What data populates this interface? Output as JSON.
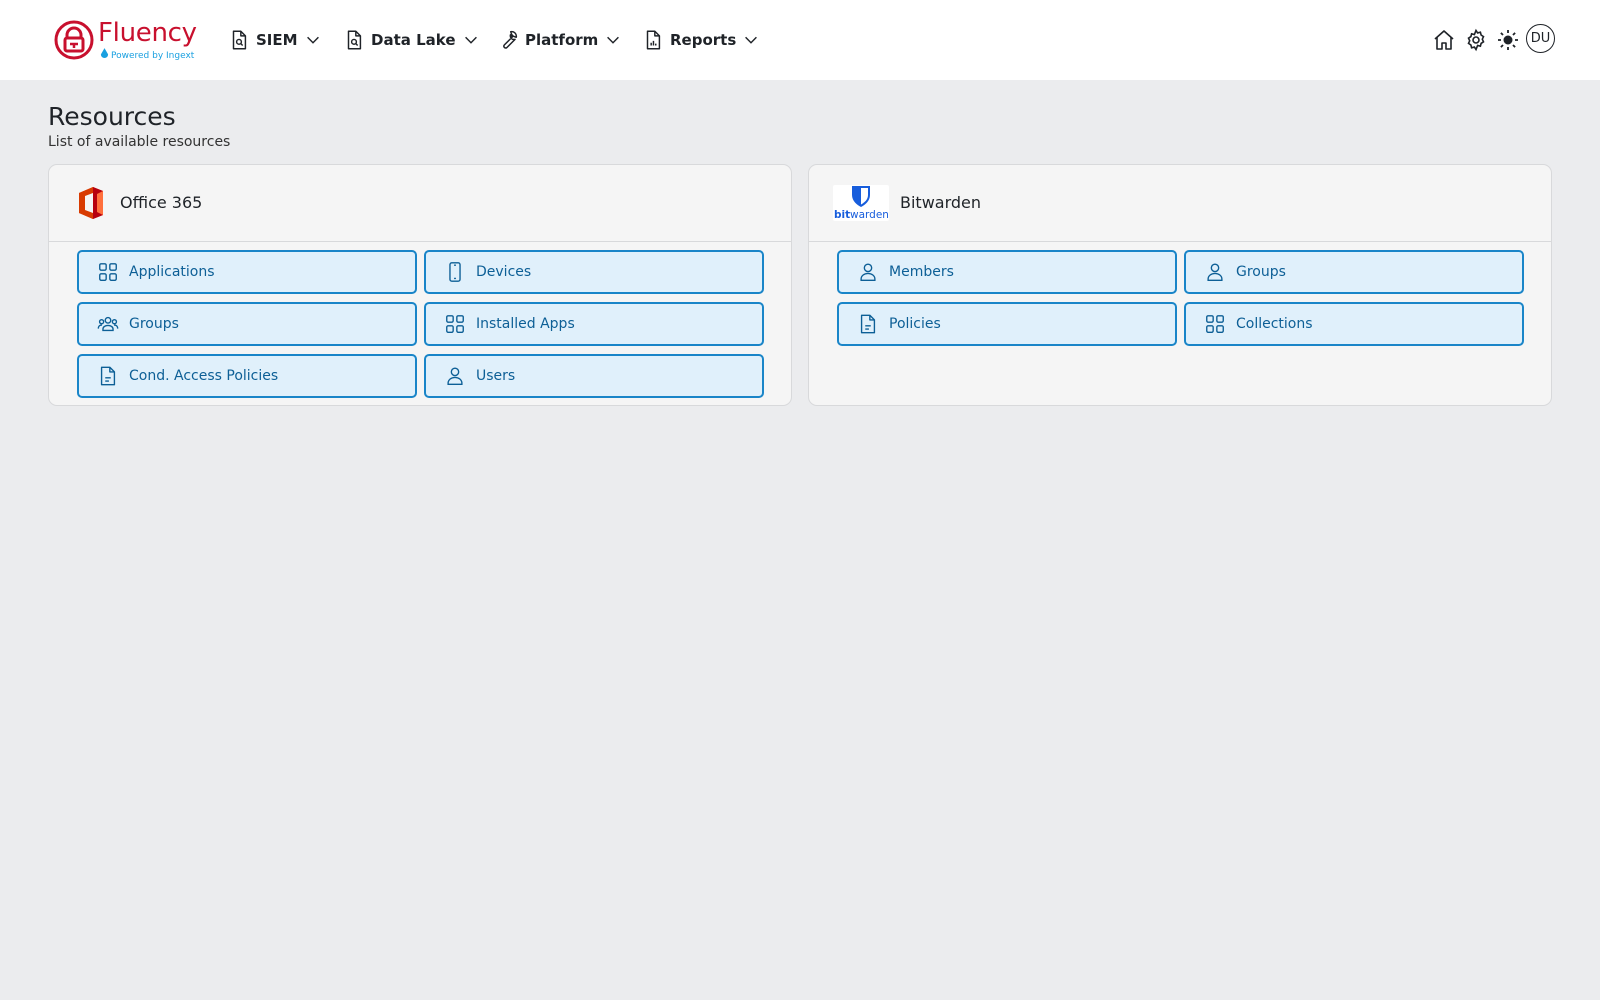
{
  "header": {
    "logo_name": "Fluency",
    "logo_subtitle": "Powered by Ingext",
    "nav": [
      {
        "label": "SIEM"
      },
      {
        "label": "Data Lake"
      },
      {
        "label": "Platform"
      },
      {
        "label": "Reports"
      }
    ],
    "avatar_initials": "DU",
    "icons": [
      "home-icon",
      "gear-icon",
      "sun-icon"
    ]
  },
  "page": {
    "title": "Resources",
    "subtitle": "List of available resources"
  },
  "resources": [
    {
      "name": "Office 365",
      "items": [
        {
          "label": "Applications",
          "icon": "grid-icon"
        },
        {
          "label": "Devices",
          "icon": "phone-icon"
        },
        {
          "label": "Groups",
          "icon": "users-icon"
        },
        {
          "label": "Installed Apps",
          "icon": "grid-icon"
        },
        {
          "label": "Cond. Access Policies",
          "icon": "document-icon"
        },
        {
          "label": "Users",
          "icon": "user-icon"
        }
      ]
    },
    {
      "name": "Bitwarden",
      "logo_text_bold": "bit",
      "logo_text": "warden",
      "items": [
        {
          "label": "Members",
          "icon": "user-icon"
        },
        {
          "label": "Groups",
          "icon": "user-icon"
        },
        {
          "label": "Policies",
          "icon": "document-icon"
        },
        {
          "label": "Collections",
          "icon": "grid-icon"
        }
      ]
    }
  ],
  "colors": {
    "brand_red": "#c8102e",
    "accent_blue": "#1a85c8",
    "button_bg": "#e0f0fb",
    "page_bg": "#ebecee"
  }
}
